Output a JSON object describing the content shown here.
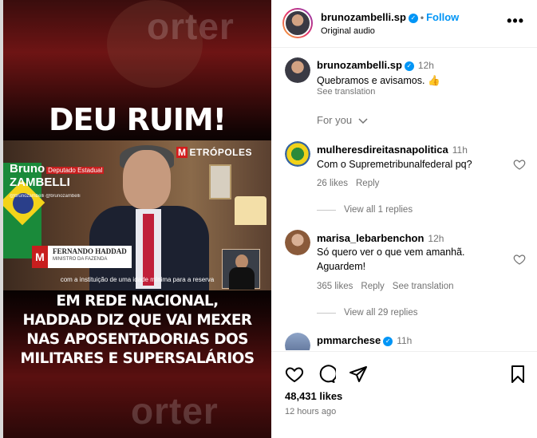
{
  "post": {
    "username": "brunozambelli.sp",
    "follow_label": "Follow",
    "audio": "Original audio",
    "more_label": "•••"
  },
  "media": {
    "bg_word": "orter",
    "headline": "DEU RUIM!",
    "brand_first": "Bruno",
    "brand_last": "ZAMBELLI",
    "brand_sub": "Deputado Estadual",
    "brand_social": "@brunozambelli   @brunozambelli",
    "outlet": "ETRÓPOLES",
    "outlet_m": "M",
    "lower_third_logo": "M",
    "lower_third_name": "FERNANDO HADDAD",
    "lower_third_role": "MINISTRO DA FAZENDA",
    "subtitle": "com a instituição de uma idade mínima para a reserva",
    "caption_lines": [
      "EM REDE NACIONAL,",
      "HADDAD DIZ QUE VAI MEXER",
      "NAS APOSENTADORIAS DOS",
      "MILITARES E SUPERSALÁRIOS"
    ]
  },
  "caption": {
    "username": "brunozambelli.sp",
    "time": "12h",
    "text": "Quebramos e avisamos. 👍",
    "see_translation": "See translation"
  },
  "for_you": "For you",
  "comments": [
    {
      "username": "mulheresdireitasnapolitica",
      "time": "11h",
      "text": "Com o Supremetribunalfederal pq?",
      "likes": "26 likes",
      "reply": "Reply",
      "view_replies": "View all 1 replies"
    },
    {
      "username": "marisa_lebarbenchon",
      "time": "12h",
      "text_lines": [
        "Só quero ver o que vem amanhã.",
        "Aguardem!"
      ],
      "likes": "365 likes",
      "reply": "Reply",
      "see_translation": "See translation",
      "view_replies": "View all 29 replies"
    },
    {
      "username": "pmmarchese",
      "time": "11h"
    }
  ],
  "stats": {
    "likes": "48,431 likes",
    "date": "12 hours ago"
  },
  "icons": [
    "heart-icon",
    "comment-icon",
    "share-icon",
    "bookmark-icon",
    "verified-icon",
    "chevron-down-icon",
    "more-icon"
  ],
  "colors": {
    "accent": "#0095f6",
    "muted": "#737373",
    "divider": "#efefef"
  }
}
